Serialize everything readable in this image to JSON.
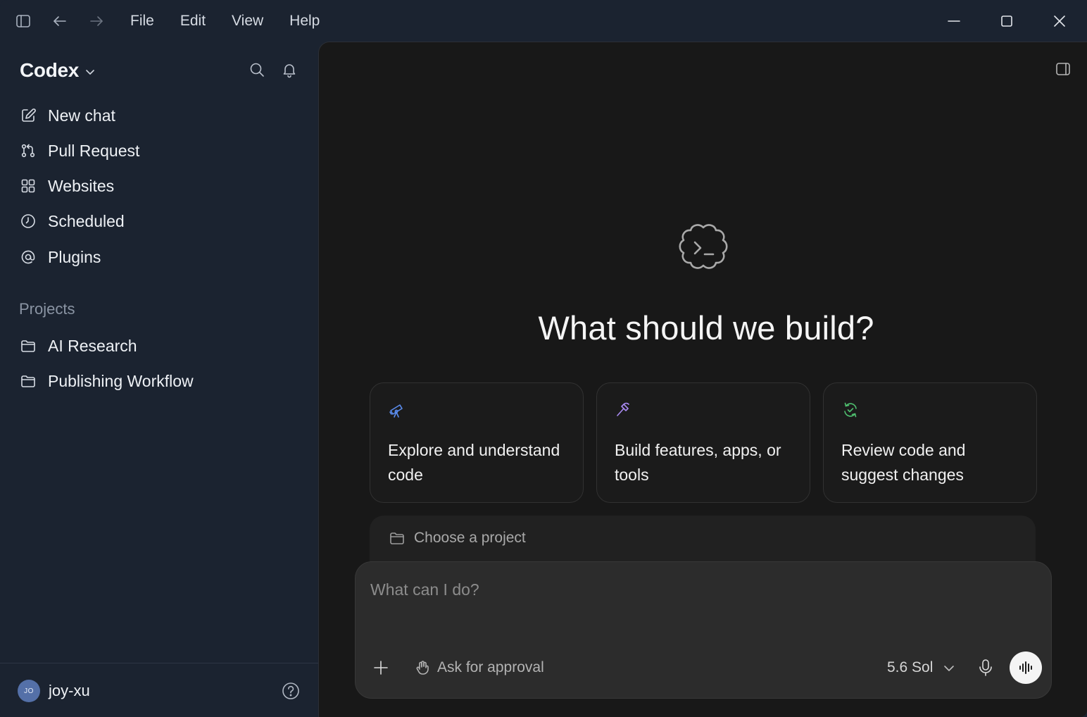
{
  "menu": {
    "items": [
      "File",
      "Edit",
      "View",
      "Help"
    ]
  },
  "sidebar": {
    "app_title": "Codex",
    "nav": [
      {
        "label": "New chat",
        "icon": "compose-icon"
      },
      {
        "label": "Pull Request",
        "icon": "git-pull-request-icon"
      },
      {
        "label": "Websites",
        "icon": "grid-icon"
      },
      {
        "label": "Scheduled",
        "icon": "clock-icon"
      },
      {
        "label": "Plugins",
        "icon": "at-sign-icon"
      }
    ],
    "projects_label": "Projects",
    "projects": [
      {
        "label": "AI Research",
        "icon": "folder-icon"
      },
      {
        "label": "Publishing Workflow",
        "icon": "folder-icon"
      }
    ],
    "user": {
      "initials": "JO",
      "name": "joy-xu"
    }
  },
  "main": {
    "headline": "What should we build?",
    "cards": [
      {
        "text": "Explore and understand code",
        "icon": "telescope-icon",
        "color": "#5b8def"
      },
      {
        "text": "Build features, apps, or tools",
        "icon": "hammer-icon",
        "color": "#a98af2"
      },
      {
        "text": "Review code and suggest changes",
        "icon": "refresh-check-icon",
        "color": "#4fbf6f"
      }
    ],
    "project_picker": "Choose a project",
    "composer": {
      "placeholder": "What can I do?",
      "approval_label": "Ask for approval",
      "model_label": "5.6 Sol"
    }
  }
}
